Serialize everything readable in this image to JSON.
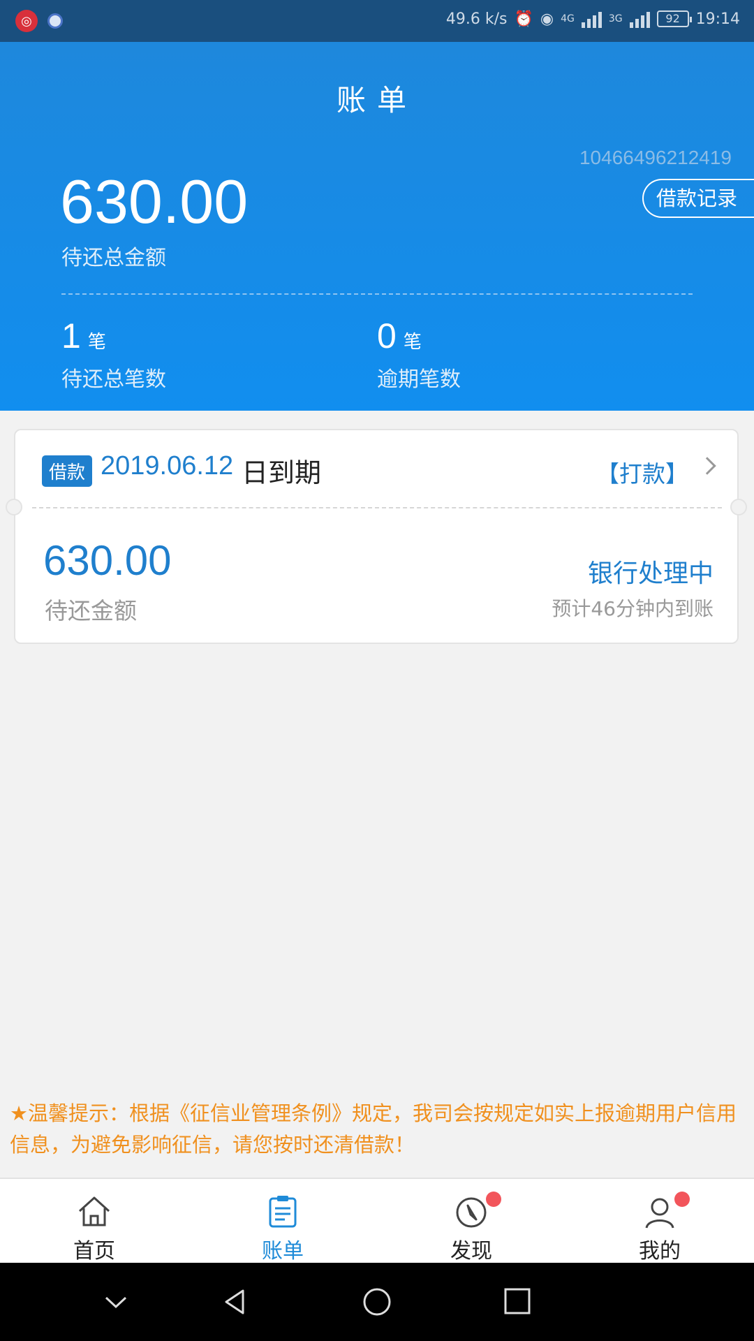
{
  "status_bar": {
    "speed": "49.6 k/s",
    "net_4g": "4G",
    "net_3g": "3G",
    "battery": "92",
    "time": "19:14"
  },
  "header": {
    "title": "账单",
    "reference_number": "10466496212419",
    "loan_record_button": "借款记录",
    "total_amount": "630.00",
    "total_amount_label": "待还总金额",
    "pending_count": "1",
    "pending_unit": "笔",
    "pending_label": "待还总笔数",
    "overdue_count": "0",
    "overdue_unit": "笔",
    "overdue_label": "逾期笔数"
  },
  "bill_card": {
    "tag": "借款",
    "due_date": "2019.06.12",
    "due_suffix": "日到期",
    "pay_link": "【打款】",
    "amount": "630.00",
    "amount_label": "待还金额",
    "status": "银行处理中",
    "status_note": "预计46分钟内到账"
  },
  "notice": "★温馨提示：根据《征信业管理条例》规定，我司会按规定如实上报逾期用户信用信息，为避免影响征信，请您按时还清借款！",
  "tabs": [
    {
      "label": "首页",
      "icon": "home-icon"
    },
    {
      "label": "账单",
      "icon": "bill-icon"
    },
    {
      "label": "发现",
      "icon": "compass-icon"
    },
    {
      "label": "我的",
      "icon": "user-icon"
    }
  ],
  "colors": {
    "primary": "#1f7fcd",
    "header_blue": "#1e88dc",
    "notice_orange": "#f0901e",
    "badge_red": "#f2555b"
  }
}
